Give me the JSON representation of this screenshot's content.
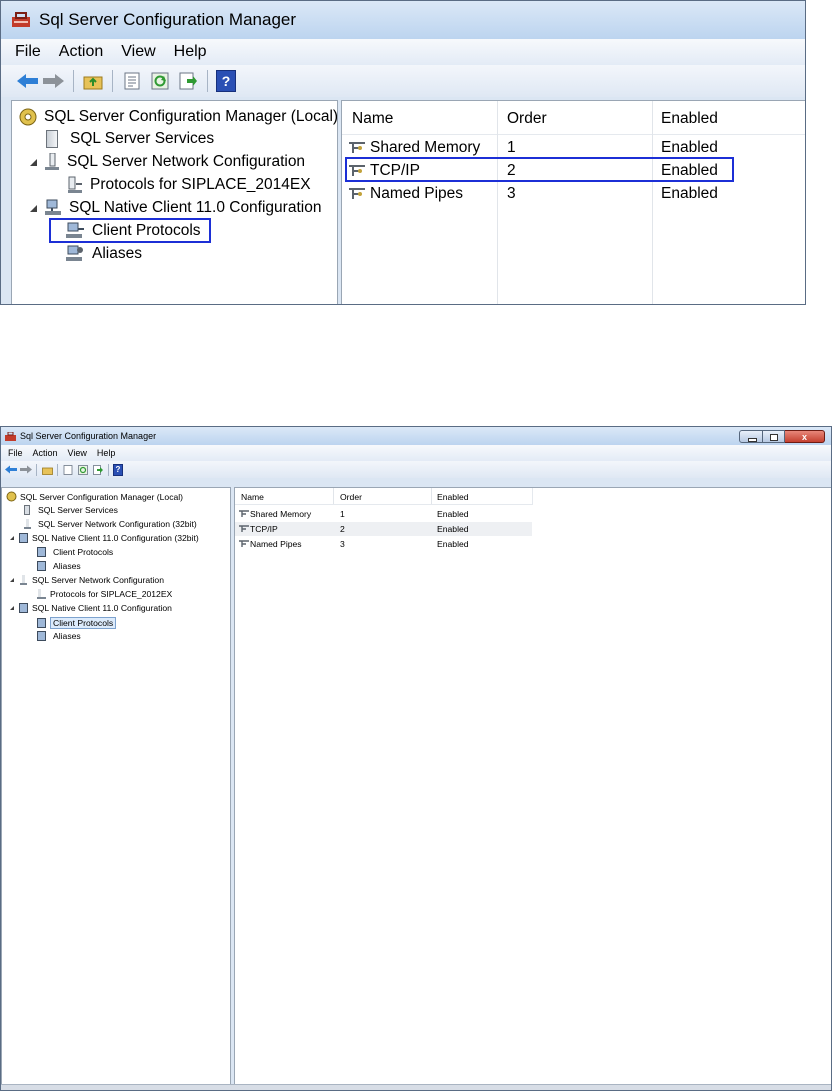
{
  "app_title": "Sql Server Configuration Manager",
  "menu": [
    "File",
    "Action",
    "View",
    "Help"
  ],
  "toolbar_icons": [
    "back-arrow-icon",
    "forward-arrow-icon",
    "up-folder-icon",
    "properties-icon",
    "refresh-icon",
    "export-list-icon",
    "help-icon"
  ],
  "colors": {
    "highlight_box": "#1c2fd6",
    "title_gradient_top": "#dbe8f7",
    "close_button": "#c4402f"
  },
  "zoomed": {
    "tree": {
      "root": "SQL Server Configuration Manager (Local)",
      "items": [
        "SQL Server Services",
        "SQL Server Network Configuration",
        "Protocols for SIPLACE_2014EX",
        "SQL Native Client 11.0 Configuration",
        "Client Protocols",
        "Aliases"
      ]
    },
    "columns": [
      "Name",
      "Order",
      "Enabled"
    ],
    "rows": [
      {
        "name": "Shared Memory",
        "order": "1",
        "enabled": "Enabled"
      },
      {
        "name": "TCP/IP",
        "order": "2",
        "enabled": "Enabled"
      },
      {
        "name": "Named Pipes",
        "order": "3",
        "enabled": "Enabled"
      }
    ]
  },
  "full": {
    "tree": {
      "root": "SQL Server Configuration Manager (Local)",
      "items": [
        "SQL Server Services",
        "SQL Server Network Configuration (32bit)",
        "SQL Native Client 11.0 Configuration (32bit)",
        "Client Protocols",
        "Aliases",
        "SQL Server Network Configuration",
        "Protocols for SIPLACE_2012EX",
        "SQL Native Client 11.0 Configuration",
        "Client Protocols",
        "Aliases"
      ]
    },
    "columns": [
      "Name",
      "Order",
      "Enabled"
    ],
    "rows": [
      {
        "name": "Shared Memory",
        "order": "1",
        "enabled": "Enabled"
      },
      {
        "name": "TCP/IP",
        "order": "2",
        "enabled": "Enabled"
      },
      {
        "name": "Named Pipes",
        "order": "3",
        "enabled": "Enabled"
      }
    ]
  }
}
